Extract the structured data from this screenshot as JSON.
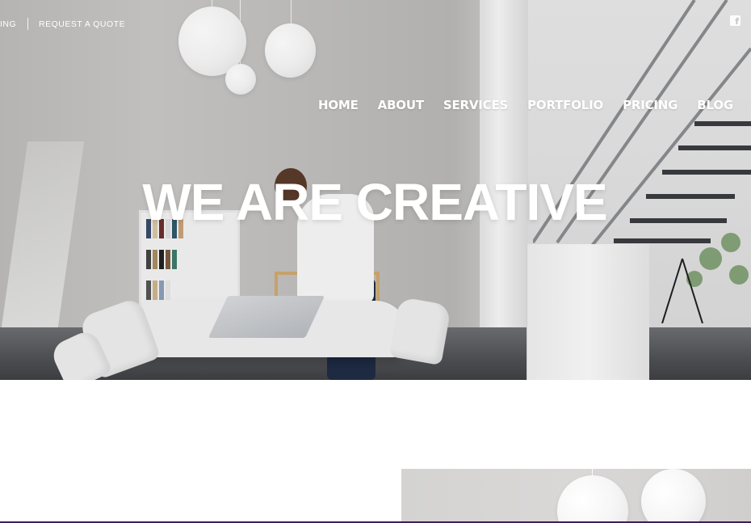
{
  "topbar": {
    "link_left_partial": "ING",
    "link_request_quote": "REQUEST A QUOTE",
    "social_icon": "facebook-icon"
  },
  "nav": {
    "items": [
      {
        "label": "HOME"
      },
      {
        "label": "ABOUT"
      },
      {
        "label": "SERVICES"
      },
      {
        "label": "PORTFOLIO"
      },
      {
        "label": "PRICING"
      },
      {
        "label": "BLOG"
      }
    ]
  },
  "hero": {
    "headline": "WE ARE CREATIVE"
  },
  "colors": {
    "text_on_hero": "#ffffff",
    "page_background": "#ffffff",
    "bottom_accent": "#3d1f5c"
  }
}
